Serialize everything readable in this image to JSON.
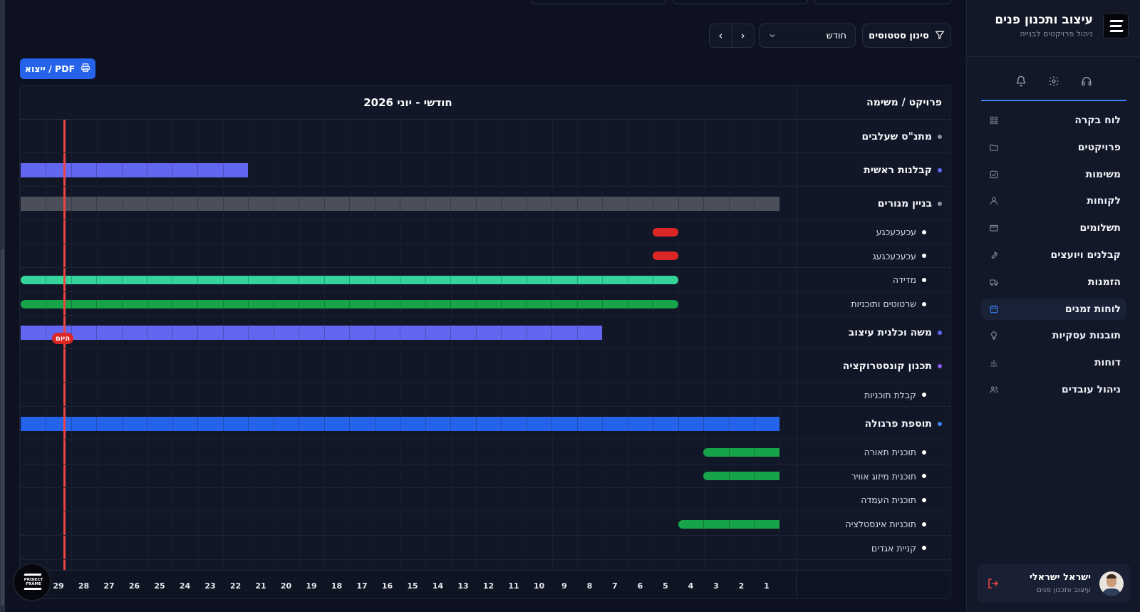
{
  "sidebar": {
    "brand_title": "עיצוב ותכנון פנים",
    "brand_subtitle": "ניהול פרויקטים לבנייה",
    "top_icons": [
      "headset-icon",
      "gear-icon",
      "bell-icon"
    ],
    "items": [
      {
        "label": "לוח בקרה",
        "icon": "dashboard-icon"
      },
      {
        "label": "פרויקטים",
        "icon": "folder-icon"
      },
      {
        "label": "משימות",
        "icon": "checkbox-icon"
      },
      {
        "label": "לקוחות",
        "icon": "user-icon"
      },
      {
        "label": "תשלומים",
        "icon": "credit-card-icon"
      },
      {
        "label": "קבלנים ויועצים",
        "icon": "wrench-icon"
      },
      {
        "label": "הזמנות",
        "icon": "truck-icon"
      },
      {
        "label": "לוחות זמנים",
        "icon": "calendar-icon",
        "active": true
      },
      {
        "label": "תובנות עסקיות",
        "icon": "lightbulb-icon"
      },
      {
        "label": "דוחות",
        "icon": "bar-chart-icon"
      },
      {
        "label": "ניהול עובדים",
        "icon": "users-icon"
      }
    ],
    "user": {
      "name": "ישראל ישראלי",
      "role": "עיצוב ותכנון פנים"
    }
  },
  "toolbar": {
    "filter_label": "סינון סטטוסים",
    "view_select_value": "חודש",
    "export_label": "ייצוא / PDF"
  },
  "gantt": {
    "title": "חודשי - יוני 2026",
    "column_header": "פרויקט / משימה",
    "today_label": "היום",
    "today_day": 30,
    "days_in_month": 30,
    "rows": [
      {
        "label": "מתנ\"ס שעלבים",
        "level": "parent",
        "dot": "#8a8f9c",
        "bar": null
      },
      {
        "label": "קבלנות ראשית",
        "level": "parent",
        "dot": "#6366f1",
        "bar": {
          "start": 22,
          "end": 30,
          "color": "#6366f1",
          "shape": "flat"
        }
      },
      {
        "label": "בניין מגורים",
        "level": "parent",
        "dot": "#8a8f9c",
        "bar": {
          "start": 1,
          "end": 30,
          "color": "#4b4f5a",
          "shape": "flat"
        }
      },
      {
        "label": "עכעכעכגע",
        "level": "child",
        "dot": "#ffffff",
        "bar": {
          "start": 5,
          "end": 5,
          "color": "#dc2626",
          "shape": "pill"
        }
      },
      {
        "label": "עכעכעכגעג",
        "level": "child",
        "dot": "#ffffff",
        "bar": {
          "start": 5,
          "end": 5,
          "color": "#dc2626",
          "shape": "pill"
        }
      },
      {
        "label": "מדידה",
        "level": "child",
        "dot": "#ffffff",
        "bar": {
          "start": 5,
          "end": 30,
          "color": "#34d399",
          "shape": "pill"
        }
      },
      {
        "label": "שרטוטים ותוכניות",
        "level": "child",
        "dot": "#ffffff",
        "bar": {
          "start": 5,
          "end": 30,
          "color": "#16a34a",
          "shape": "pill"
        }
      },
      {
        "label": "משה וכלנית עיצוב",
        "level": "parent",
        "dot": "#6366f1",
        "bar": {
          "start": 8,
          "end": 30,
          "color": "#6366f1",
          "shape": "flat"
        }
      },
      {
        "label": "תכנון קונסטרוקציה",
        "level": "parent",
        "dot": "#8b5cf6",
        "bar": null
      },
      {
        "label": "קבלת תוכניות",
        "level": "child",
        "dot": "#ffffff",
        "bar": null
      },
      {
        "label": "תוספת פרגולה",
        "level": "parent",
        "dot": "#3b82f6",
        "bar": {
          "start": 1,
          "end": 30,
          "color": "#2563eb",
          "shape": "flat"
        }
      },
      {
        "label": "תוכנית תאורה",
        "level": "child",
        "dot": "#ffffff",
        "bar": {
          "start": 1,
          "end": 3,
          "color": "#16a34a",
          "shape": "pill-right"
        }
      },
      {
        "label": "תוכנית מיזוג אוויר",
        "level": "child",
        "dot": "#ffffff",
        "bar": {
          "start": 1,
          "end": 3,
          "color": "#16a34a",
          "shape": "pill-right"
        }
      },
      {
        "label": "תוכנית העמדה",
        "level": "child",
        "dot": "#ffffff",
        "bar": null
      },
      {
        "label": "תוכניות אינסטלציה",
        "level": "child",
        "dot": "#ffffff",
        "bar": {
          "start": 1,
          "end": 4,
          "color": "#16a34a",
          "shape": "pill-right"
        }
      },
      {
        "label": "קניית אגדים",
        "level": "child",
        "dot": "#ffffff",
        "bar": null
      }
    ],
    "day_labels": [
      "1",
      "2",
      "3",
      "4",
      "5",
      "6",
      "7",
      "8",
      "9",
      "10",
      "11",
      "12",
      "13",
      "14",
      "15",
      "16",
      "17",
      "18",
      "19",
      "20",
      "21",
      "22",
      "23",
      "24",
      "25",
      "26",
      "27",
      "28",
      "29"
    ]
  }
}
